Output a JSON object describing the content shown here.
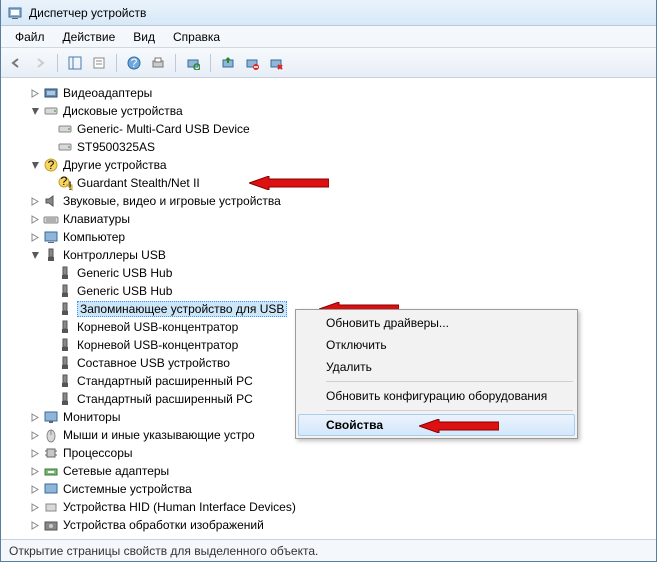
{
  "title": "Диспетчер устройств",
  "menu": {
    "file": "Файл",
    "action": "Действие",
    "view": "Вид",
    "help": "Справка"
  },
  "tree": {
    "videoAdapters": "Видеоадаптеры",
    "diskDrives": "Дисковые устройства",
    "disk1": "Generic- Multi-Card USB Device",
    "disk2": "ST9500325AS",
    "otherDevices": "Другие устройства",
    "other1": "Guardant Stealth/Net II",
    "sound": "Звуковые, видео и игровые устройства",
    "keyboards": "Клавиатуры",
    "computer": "Компьютер",
    "usbControllers": "Контроллеры USB",
    "usb1": "Generic USB Hub",
    "usb2": "Generic USB Hub",
    "usb3": "Запоминающее устройство для USB",
    "usb4": "Корневой USB-концентратор",
    "usb5": "Корневой USB-концентратор",
    "usb6": "Составное USB устройство",
    "usb7": "Стандартный расширенный PC",
    "usb8": "Стандартный расширенный PC",
    "monitors": "Мониторы",
    "mice": "Мыши и иные указывающие устро",
    "processors": "Процессоры",
    "netAdapters": "Сетевые адаптеры",
    "sysDevices": "Системные устройства",
    "hid": "Устройства HID (Human Interface Devices)",
    "imaging": "Устройства обработки изображений"
  },
  "context": {
    "updateDrivers": "Обновить драйверы...",
    "disable": "Отключить",
    "delete": "Удалить",
    "scanHardware": "Обновить конфигурацию оборудования",
    "properties": "Свойства"
  },
  "status": "Открытие страницы свойств для выделенного объекта."
}
